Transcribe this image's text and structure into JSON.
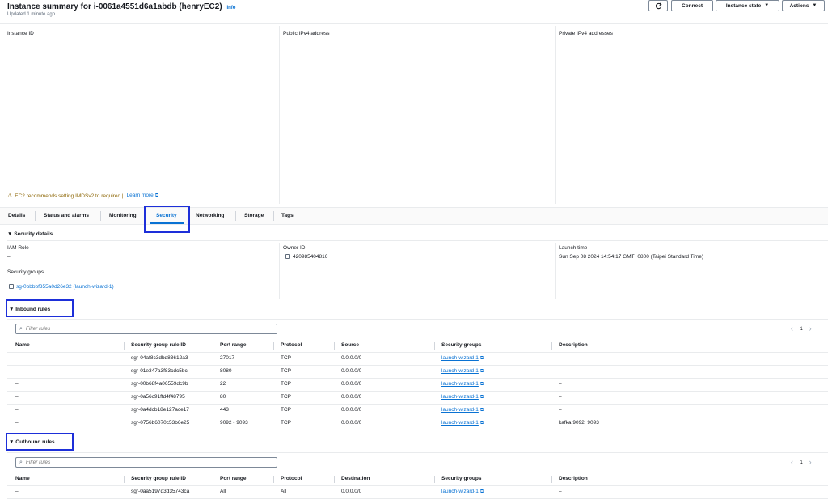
{
  "header": {
    "title": "Instance summary for i-0061a4551d6a1abdb (henryEC2)",
    "info": "Info",
    "updated": "Updated 1 minute ago",
    "refresh_icon": "refresh-icon",
    "connect": "Connect",
    "instance_state": "Instance state",
    "actions": "Actions"
  },
  "summary": {
    "columns": [
      "Instance ID",
      "Public IPv4 address",
      "Private IPv4 addresses"
    ],
    "warning": "EC2 recommends setting IMDSv2 to required |",
    "learn_more": "Learn more"
  },
  "tabs": [
    "Details",
    "Status and alarms",
    "Monitoring",
    "Security",
    "Networking",
    "Storage",
    "Tags"
  ],
  "active_tab": "Security",
  "security_details": {
    "heading": "Security details",
    "iam_role_label": "IAM Role",
    "iam_role_value": "–",
    "owner_id_label": "Owner ID",
    "owner_id_value": "420985404816",
    "launch_time_label": "Launch time",
    "launch_time_value": "Sun Sep 08 2024 14:54:17 GMT+0800 (Taipei Standard Time)",
    "security_groups_label": "Security groups",
    "security_groups_value": "sg-0bbbbf355a0d26e32 (launch-wizard-1)"
  },
  "inbound": {
    "heading": "Inbound rules",
    "filter_placeholder": "Filter rules",
    "page": "1",
    "headers": [
      "Name",
      "Security group rule ID",
      "Port range",
      "Protocol",
      "Source",
      "Security groups",
      "Description"
    ],
    "rows": [
      [
        "–",
        "sgr-04af8c3dbd83612a3",
        "27017",
        "TCP",
        "0.0.0.0/0",
        "launch-wizard-1",
        "–"
      ],
      [
        "–",
        "sgr-01e347a3f83cdc5bc",
        "8080",
        "TCP",
        "0.0.0.0/0",
        "launch-wizard-1",
        "–"
      ],
      [
        "–",
        "sgr-00b68f4a06559dc9b",
        "22",
        "TCP",
        "0.0.0.0/0",
        "launch-wizard-1",
        "–"
      ],
      [
        "–",
        "sgr-0a56c91ffd4f48795",
        "80",
        "TCP",
        "0.0.0.0/0",
        "launch-wizard-1",
        "–"
      ],
      [
        "–",
        "sgr-0a4dcb18e127ace17",
        "443",
        "TCP",
        "0.0.0.0/0",
        "launch-wizard-1",
        "–"
      ],
      [
        "–",
        "sgr-0756b6070c53b6e25",
        "9092 - 9093",
        "TCP",
        "0.0.0.0/0",
        "launch-wizard-1",
        "kafka 9092, 9093"
      ]
    ]
  },
  "outbound": {
    "heading": "Outbound rules",
    "filter_placeholder": "Filter rules",
    "page": "1",
    "headers": [
      "Name",
      "Security group rule ID",
      "Port range",
      "Protocol",
      "Destination",
      "Security groups",
      "Description"
    ],
    "rows": [
      [
        "–",
        "sgr-0aa5197d3d35743ca",
        "All",
        "All",
        "0.0.0.0/0",
        "launch-wizard-1",
        "–"
      ]
    ]
  },
  "colors": {
    "link": "#0972d3",
    "highlight": "#1d2fd9",
    "warning": "#8d6605"
  }
}
